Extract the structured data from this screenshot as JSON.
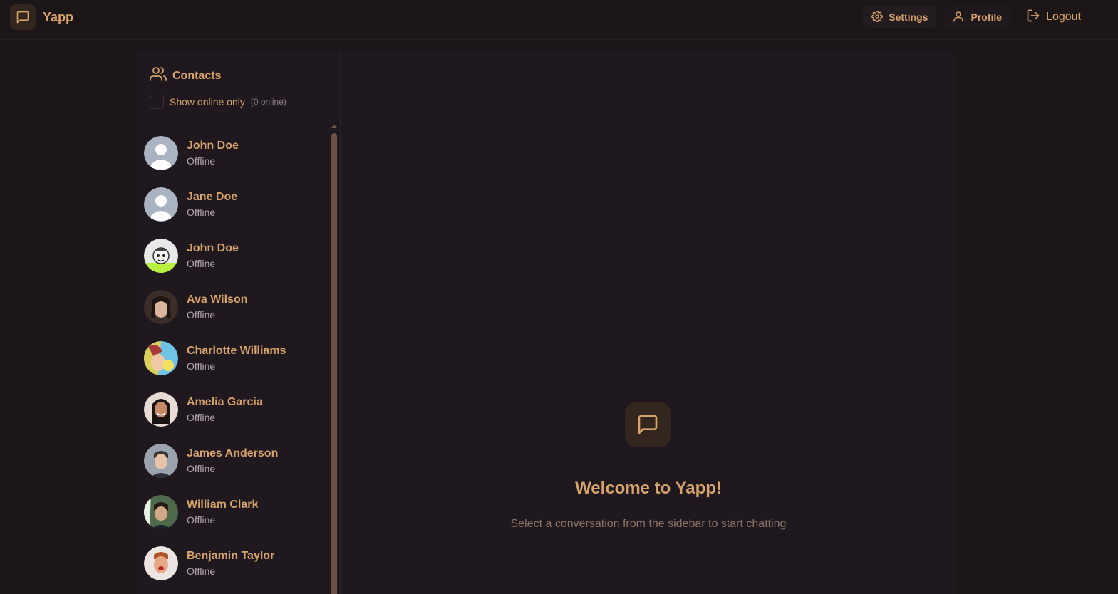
{
  "app": {
    "name": "Yapp"
  },
  "nav": {
    "settings_label": "Settings",
    "profile_label": "Profile",
    "logout_label": "Logout"
  },
  "sidebar": {
    "title": "Contacts",
    "filter_label": "Show online only",
    "online_count": "(0 online)",
    "contacts": [
      {
        "name": "John Doe",
        "status": "Offline",
        "avatar": "default"
      },
      {
        "name": "Jane Doe",
        "status": "Offline",
        "avatar": "default"
      },
      {
        "name": "John Doe",
        "status": "Offline",
        "avatar": "cartoon"
      },
      {
        "name": "Ava Wilson",
        "status": "Offline",
        "avatar": "photo"
      },
      {
        "name": "Charlotte Williams",
        "status": "Offline",
        "avatar": "photo"
      },
      {
        "name": "Amelia Garcia",
        "status": "Offline",
        "avatar": "photo"
      },
      {
        "name": "James Anderson",
        "status": "Offline",
        "avatar": "photo"
      },
      {
        "name": "William Clark",
        "status": "Offline",
        "avatar": "photo"
      },
      {
        "name": "Benjamin Taylor",
        "status": "Offline",
        "avatar": "photo"
      }
    ]
  },
  "welcome": {
    "title": "Welcome to Yapp!",
    "subtitle": "Select a conversation from the sidebar to start chatting"
  },
  "colors": {
    "accent": "#d6a36b",
    "background": "#1c1619",
    "panel": "#1f181e"
  }
}
